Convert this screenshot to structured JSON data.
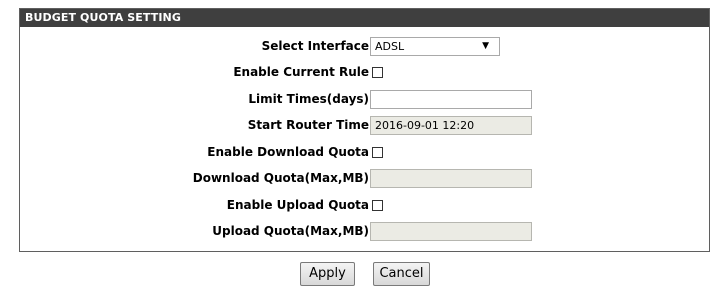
{
  "panel": {
    "title": "BUDGET QUOTA SETTING"
  },
  "fields": {
    "select_interface": {
      "label": "Select Interface :",
      "value": "ADSL",
      "arrow_icon": "triangle-down"
    },
    "enable_current_rule": {
      "label": "Enable Current Rule :",
      "checked": false
    },
    "limit_times": {
      "label": "Limit Times(days) :",
      "value": ""
    },
    "start_router_time": {
      "label": "Start Router Time :",
      "value": "2016-09-01 12:20"
    },
    "enable_download_quota": {
      "label": "Enable Download Quota :",
      "checked": false
    },
    "download_quota": {
      "label": "Download Quota(Max,MB) :",
      "value": ""
    },
    "enable_upload_quota": {
      "label": "Enable Upload Quota :",
      "checked": false
    },
    "upload_quota": {
      "label": "Upload Quota(Max,MB) :",
      "value": ""
    }
  },
  "buttons": {
    "apply_label": "Apply",
    "cancel_label": "Cancel"
  },
  "colors": {
    "header_bg": "#3f3f3f",
    "header_text": "#ffffff",
    "disabled_input_bg": "#ebebe4"
  }
}
